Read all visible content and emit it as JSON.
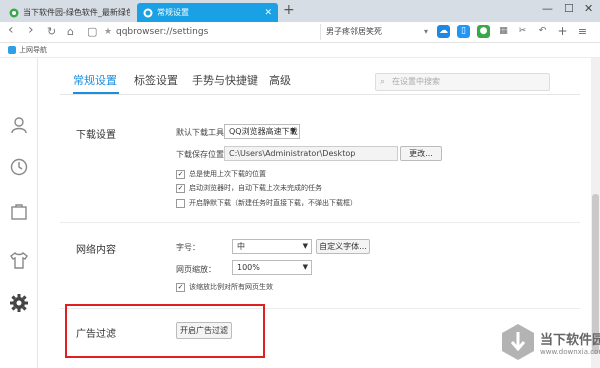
{
  "tabs": [
    {
      "title": "当下软件园-绿色软件_最新绿色下载站",
      "active": false
    },
    {
      "title": "常规设置",
      "active": true
    }
  ],
  "window_controls": {
    "minimize": "—",
    "maximize": "☐",
    "close": "✕"
  },
  "nav": {
    "back": "‹",
    "forward": "›",
    "refresh": "↻",
    "home": "⌂",
    "reader": "▢",
    "star": "★",
    "address": "qqbrowser://settings",
    "search_text": "男子疼邻居笑死"
  },
  "bookmarks": [
    {
      "label": "上网导航"
    }
  ],
  "settings": {
    "tabs": [
      "常规设置",
      "标签设置",
      "手势与快捷键",
      "高级"
    ],
    "search_placeholder": "在设置中搜索",
    "download": {
      "title": "下载设置",
      "default_tool_label": "默认下载工具",
      "default_tool_value": "QQ浏览器高速下载",
      "save_location_label": "下载保存位置",
      "save_location_value": "C:\\Users\\Administrator\\Desktop",
      "change_button": "更改...",
      "options": [
        {
          "label": "总是使用上次下载的位置",
          "checked": true
        },
        {
          "label": "启动浏览器时，自动下载上次未完成的任务",
          "checked": true
        },
        {
          "label": "开启静默下载（新建任务时直接下载，不弹出下载框）",
          "checked": false
        }
      ]
    },
    "web_content": {
      "title": "网络内容",
      "font_size_label": "字号：",
      "font_size_value": "中",
      "custom_font_button": "自定义字体...",
      "zoom_label": "网页缩放：",
      "zoom_value": "100%",
      "zoom_option": {
        "label": "该缩放比例对所有网页生效",
        "checked": true
      }
    },
    "ad_filter": {
      "title": "广告过滤",
      "button": "开启广告过滤"
    }
  },
  "watermark": {
    "name": "当下软件园",
    "url": "www.downxia.com"
  },
  "colors": {
    "accent": "#1a8fe0",
    "active_tab": "#1aa1e5",
    "highlight": "#e02020"
  }
}
